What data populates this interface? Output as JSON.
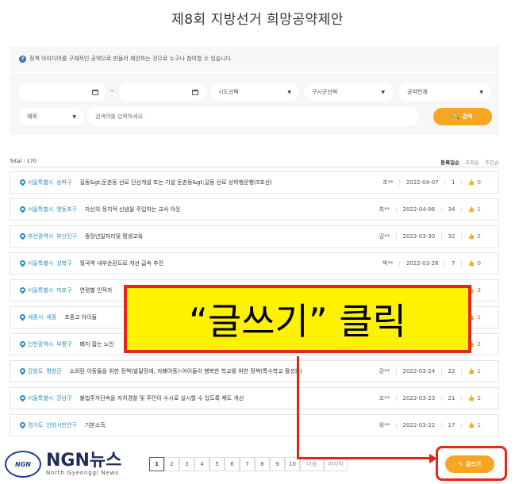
{
  "page": {
    "title": "제8회 지방선거 희망공약제안"
  },
  "info": {
    "text": "정책 아이디어를 구체적인 공약으로 만들어 제안하는 것으로 누구나 참여할 수 있습니다."
  },
  "search": {
    "tilde": "~",
    "sido": "시도선택",
    "gugun": "구시군선택",
    "pledge": "공약전체",
    "field": "제목",
    "placeholder": "검색어를 입력하세요.",
    "button": "검색"
  },
  "list": {
    "total": "Total : 170",
    "sort": [
      "등록일순",
      "조회순",
      "추천순"
    ],
    "rows": [
      {
        "region": "서울특별시",
        "sub": "송파구",
        "title": "길동&gt;둔촌동 선로 단선개설 또는 기설 둔촌동&gt;길동 선로 상하행운행(5호선)",
        "author": "조**",
        "date": "2022-04-07",
        "views": "1",
        "likes": "0"
      },
      {
        "region": "서울특별시",
        "sub": "영등포구",
        "title": "자신의 정치적 신념을 주입하는 교사 아웃",
        "author": "최**",
        "date": "2022-04-06",
        "views": "34",
        "likes": "1"
      },
      {
        "region": "부산광역시",
        "sub": "부산진구",
        "title": "중장년일자리및 평생교육",
        "author": "김**",
        "date": "2022-03-30",
        "views": "32",
        "likes": "2"
      },
      {
        "region": "서울특별시",
        "sub": "성북구",
        "title": "월곡역 내부순환도로 개선 급속 추진",
        "author": "박**",
        "date": "2022-03-28",
        "views": "7",
        "likes": "0"
      },
      {
        "region": "서울특별시",
        "sub": "마포구",
        "title": "연령별 인적자",
        "author": "",
        "date": "",
        "views": "",
        "likes": "3"
      },
      {
        "region": "세종시",
        "sub": "세종",
        "title": "초중고 아이들",
        "author": "",
        "date": "",
        "views": "",
        "likes": "1"
      },
      {
        "region": "인천광역시",
        "sub": "부평구",
        "title": "폐지 줍는 노인",
        "author": "",
        "date": "",
        "views": "",
        "likes": "2"
      },
      {
        "region": "강원도",
        "sub": "평창군",
        "title": "소외된 아동들을 위한 정책(발달장애, 자폐아동)-아이들이 행복한 학교를 위한 정책(특수학교 활성화)",
        "author": "강**",
        "date": "2022-03-24",
        "views": "22",
        "likes": "1"
      },
      {
        "region": "서울특별시",
        "sub": "강남구",
        "title": "불법주차단속을 자치경찰 및 주민이 수시로 실시할 수 있도록 제도 개선",
        "author": "조**",
        "date": "2022-03-23",
        "views": "21",
        "likes": "2"
      },
      {
        "region": "경기도",
        "sub": "안양시만안구",
        "title": "기본소득",
        "author": "위**",
        "date": "2022-03-22",
        "views": "17",
        "likes": "1"
      }
    ]
  },
  "pagination": {
    "pages": [
      "1",
      "2",
      "3",
      "4",
      "5",
      "6",
      "7",
      "8",
      "9",
      "10"
    ],
    "next": "다음",
    "last": "마지막"
  },
  "write_button": "글쓰기",
  "annotation": {
    "text": "“글쓰기” 클릭"
  },
  "logo": {
    "circle": "NGN",
    "main": "NGN뉴스",
    "sub": "North Gyeonggi News"
  }
}
